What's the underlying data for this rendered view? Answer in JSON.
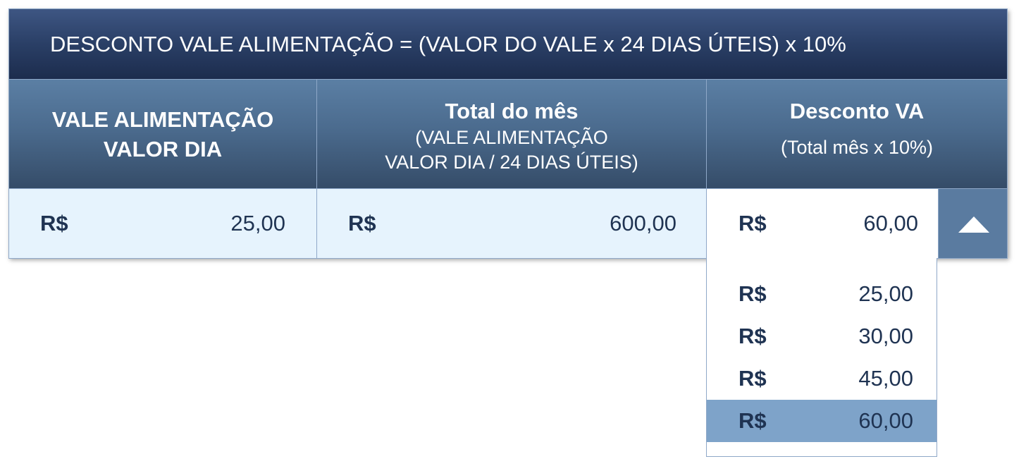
{
  "title": "DESCONTO VALE ALIMENTAÇÃO = (VALOR DO VALE x 24 DIAS ÚTEIS) x 10%",
  "columns": [
    {
      "main_line1": "VALE ALIMENTAÇÃO",
      "main_line2": "VALOR DIA"
    },
    {
      "main": "Total do mês",
      "sub_line1": "(VALE ALIMENTAÇÃO",
      "sub_line2": "VALOR DIA / 24 DIAS ÚTEIS)"
    },
    {
      "main": "Desconto VA",
      "sub": "(Total mês x 10%)"
    }
  ],
  "row": {
    "vale_dia": {
      "currency": "R$",
      "amount": "25,00"
    },
    "total_mes": {
      "currency": "R$",
      "amount": "600,00"
    },
    "desconto": {
      "currency": "R$",
      "amount": "60,00"
    }
  },
  "dropdown": {
    "expanded": true,
    "arrow_icon": "triangle-up-icon",
    "options": [
      {
        "currency": "R$",
        "amount": "25,00",
        "selected": false
      },
      {
        "currency": "R$",
        "amount": "30,00",
        "selected": false
      },
      {
        "currency": "R$",
        "amount": "45,00",
        "selected": false
      },
      {
        "currency": "R$",
        "amount": "60,00",
        "selected": true
      }
    ]
  },
  "colors": {
    "title_bg": "#2a3f66",
    "header_bg": "#4b6b8e",
    "cell_bg": "#e6f3fd",
    "selected_option_bg": "#7ea3c9",
    "text_dark": "#1f3352"
  }
}
